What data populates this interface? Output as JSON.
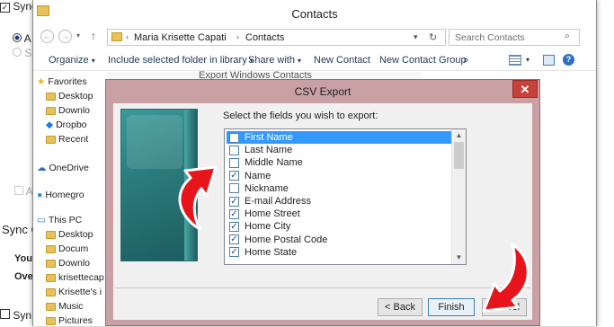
{
  "background": {
    "sync_label": "Sync",
    "sync_suffix": "C",
    "opt_a": "A",
    "opt_s": "S",
    "opt_a2": "A",
    "sync_c": "Sync C",
    "you": "You",
    "ove": "Ove",
    "syn_bottom": "Syn"
  },
  "explorer": {
    "title": "Contacts",
    "breadcrumb": [
      "Maria Krisette Capati",
      "Contacts"
    ],
    "search_placeholder": "Search Contacts",
    "commands": [
      "Organize",
      "Include selected folder in library",
      "Share with",
      "New Contact",
      "New Contact Group",
      "»"
    ],
    "nav": [
      {
        "label": "Favorites",
        "kind": "star"
      },
      {
        "label": "Desktop",
        "kind": "folder"
      },
      {
        "label": "Downlo",
        "kind": "folder"
      },
      {
        "label": "Dropbo",
        "kind": "dropbox"
      },
      {
        "label": "Recent",
        "kind": "folder"
      },
      {
        "label": "OneDrive",
        "kind": "cloud"
      },
      {
        "label": "Homegro",
        "kind": "group"
      },
      {
        "label": "This PC",
        "kind": "pc"
      },
      {
        "label": "Desktop",
        "kind": "folder"
      },
      {
        "label": "Docum",
        "kind": "folder"
      },
      {
        "label": "Downlo",
        "kind": "folder"
      },
      {
        "label": "krisettecap",
        "kind": "folder"
      },
      {
        "label": "Krisette's i",
        "kind": "folder"
      },
      {
        "label": "Music",
        "kind": "folder"
      },
      {
        "label": "Pictures",
        "kind": "folder"
      }
    ],
    "wizard_title": "Export Windows Contacts"
  },
  "csv_dialog": {
    "title": "CSV Export",
    "close_label": "✕",
    "instruction": "Select the fields you wish to export:",
    "fields": [
      {
        "label": "First Name",
        "checked": false,
        "selected": true
      },
      {
        "label": "Last Name",
        "checked": false,
        "selected": false
      },
      {
        "label": "Middle Name",
        "checked": false,
        "selected": false
      },
      {
        "label": "Name",
        "checked": true,
        "selected": false
      },
      {
        "label": "Nickname",
        "checked": false,
        "selected": false
      },
      {
        "label": "E-mail Address",
        "checked": true,
        "selected": false
      },
      {
        "label": "Home Street",
        "checked": true,
        "selected": false
      },
      {
        "label": "Home City",
        "checked": true,
        "selected": false
      },
      {
        "label": "Home Postal Code",
        "checked": true,
        "selected": false
      },
      {
        "label": "Home State",
        "checked": true,
        "selected": false
      }
    ],
    "back_label": "< Back",
    "finish_label": "Finish",
    "cancel_label": "Cancel"
  },
  "colors": {
    "dialog_frame": "#c9a1a5",
    "selection": "#3399ff",
    "annotation_arrow": "#e8141b"
  }
}
